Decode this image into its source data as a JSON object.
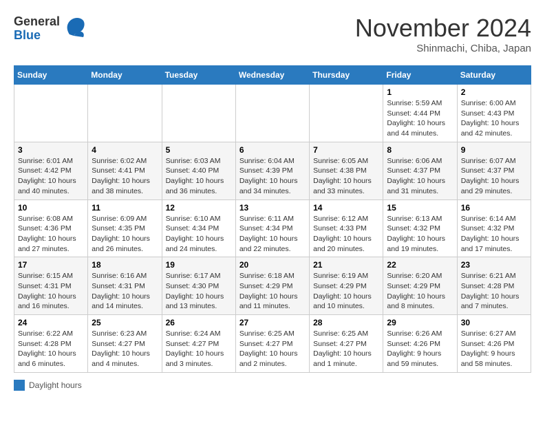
{
  "header": {
    "logo_general": "General",
    "logo_blue": "Blue",
    "month_title": "November 2024",
    "location": "Shinmachi, Chiba, Japan"
  },
  "days_of_week": [
    "Sunday",
    "Monday",
    "Tuesday",
    "Wednesday",
    "Thursday",
    "Friday",
    "Saturday"
  ],
  "footer": {
    "label": "Daylight hours"
  },
  "weeks": [
    [
      null,
      null,
      null,
      null,
      null,
      {
        "day": "1",
        "sunrise": "Sunrise: 5:59 AM",
        "sunset": "Sunset: 4:44 PM",
        "daylight": "Daylight: 10 hours and 44 minutes."
      },
      {
        "day": "2",
        "sunrise": "Sunrise: 6:00 AM",
        "sunset": "Sunset: 4:43 PM",
        "daylight": "Daylight: 10 hours and 42 minutes."
      }
    ],
    [
      {
        "day": "3",
        "sunrise": "Sunrise: 6:01 AM",
        "sunset": "Sunset: 4:42 PM",
        "daylight": "Daylight: 10 hours and 40 minutes."
      },
      {
        "day": "4",
        "sunrise": "Sunrise: 6:02 AM",
        "sunset": "Sunset: 4:41 PM",
        "daylight": "Daylight: 10 hours and 38 minutes."
      },
      {
        "day": "5",
        "sunrise": "Sunrise: 6:03 AM",
        "sunset": "Sunset: 4:40 PM",
        "daylight": "Daylight: 10 hours and 36 minutes."
      },
      {
        "day": "6",
        "sunrise": "Sunrise: 6:04 AM",
        "sunset": "Sunset: 4:39 PM",
        "daylight": "Daylight: 10 hours and 34 minutes."
      },
      {
        "day": "7",
        "sunrise": "Sunrise: 6:05 AM",
        "sunset": "Sunset: 4:38 PM",
        "daylight": "Daylight: 10 hours and 33 minutes."
      },
      {
        "day": "8",
        "sunrise": "Sunrise: 6:06 AM",
        "sunset": "Sunset: 4:37 PM",
        "daylight": "Daylight: 10 hours and 31 minutes."
      },
      {
        "day": "9",
        "sunrise": "Sunrise: 6:07 AM",
        "sunset": "Sunset: 4:37 PM",
        "daylight": "Daylight: 10 hours and 29 minutes."
      }
    ],
    [
      {
        "day": "10",
        "sunrise": "Sunrise: 6:08 AM",
        "sunset": "Sunset: 4:36 PM",
        "daylight": "Daylight: 10 hours and 27 minutes."
      },
      {
        "day": "11",
        "sunrise": "Sunrise: 6:09 AM",
        "sunset": "Sunset: 4:35 PM",
        "daylight": "Daylight: 10 hours and 26 minutes."
      },
      {
        "day": "12",
        "sunrise": "Sunrise: 6:10 AM",
        "sunset": "Sunset: 4:34 PM",
        "daylight": "Daylight: 10 hours and 24 minutes."
      },
      {
        "day": "13",
        "sunrise": "Sunrise: 6:11 AM",
        "sunset": "Sunset: 4:34 PM",
        "daylight": "Daylight: 10 hours and 22 minutes."
      },
      {
        "day": "14",
        "sunrise": "Sunrise: 6:12 AM",
        "sunset": "Sunset: 4:33 PM",
        "daylight": "Daylight: 10 hours and 20 minutes."
      },
      {
        "day": "15",
        "sunrise": "Sunrise: 6:13 AM",
        "sunset": "Sunset: 4:32 PM",
        "daylight": "Daylight: 10 hours and 19 minutes."
      },
      {
        "day": "16",
        "sunrise": "Sunrise: 6:14 AM",
        "sunset": "Sunset: 4:32 PM",
        "daylight": "Daylight: 10 hours and 17 minutes."
      }
    ],
    [
      {
        "day": "17",
        "sunrise": "Sunrise: 6:15 AM",
        "sunset": "Sunset: 4:31 PM",
        "daylight": "Daylight: 10 hours and 16 minutes."
      },
      {
        "day": "18",
        "sunrise": "Sunrise: 6:16 AM",
        "sunset": "Sunset: 4:31 PM",
        "daylight": "Daylight: 10 hours and 14 minutes."
      },
      {
        "day": "19",
        "sunrise": "Sunrise: 6:17 AM",
        "sunset": "Sunset: 4:30 PM",
        "daylight": "Daylight: 10 hours and 13 minutes."
      },
      {
        "day": "20",
        "sunrise": "Sunrise: 6:18 AM",
        "sunset": "Sunset: 4:29 PM",
        "daylight": "Daylight: 10 hours and 11 minutes."
      },
      {
        "day": "21",
        "sunrise": "Sunrise: 6:19 AM",
        "sunset": "Sunset: 4:29 PM",
        "daylight": "Daylight: 10 hours and 10 minutes."
      },
      {
        "day": "22",
        "sunrise": "Sunrise: 6:20 AM",
        "sunset": "Sunset: 4:29 PM",
        "daylight": "Daylight: 10 hours and 8 minutes."
      },
      {
        "day": "23",
        "sunrise": "Sunrise: 6:21 AM",
        "sunset": "Sunset: 4:28 PM",
        "daylight": "Daylight: 10 hours and 7 minutes."
      }
    ],
    [
      {
        "day": "24",
        "sunrise": "Sunrise: 6:22 AM",
        "sunset": "Sunset: 4:28 PM",
        "daylight": "Daylight: 10 hours and 6 minutes."
      },
      {
        "day": "25",
        "sunrise": "Sunrise: 6:23 AM",
        "sunset": "Sunset: 4:27 PM",
        "daylight": "Daylight: 10 hours and 4 minutes."
      },
      {
        "day": "26",
        "sunrise": "Sunrise: 6:24 AM",
        "sunset": "Sunset: 4:27 PM",
        "daylight": "Daylight: 10 hours and 3 minutes."
      },
      {
        "day": "27",
        "sunrise": "Sunrise: 6:25 AM",
        "sunset": "Sunset: 4:27 PM",
        "daylight": "Daylight: 10 hours and 2 minutes."
      },
      {
        "day": "28",
        "sunrise": "Sunrise: 6:25 AM",
        "sunset": "Sunset: 4:27 PM",
        "daylight": "Daylight: 10 hours and 1 minute."
      },
      {
        "day": "29",
        "sunrise": "Sunrise: 6:26 AM",
        "sunset": "Sunset: 4:26 PM",
        "daylight": "Daylight: 9 hours and 59 minutes."
      },
      {
        "day": "30",
        "sunrise": "Sunrise: 6:27 AM",
        "sunset": "Sunset: 4:26 PM",
        "daylight": "Daylight: 9 hours and 58 minutes."
      }
    ]
  ]
}
